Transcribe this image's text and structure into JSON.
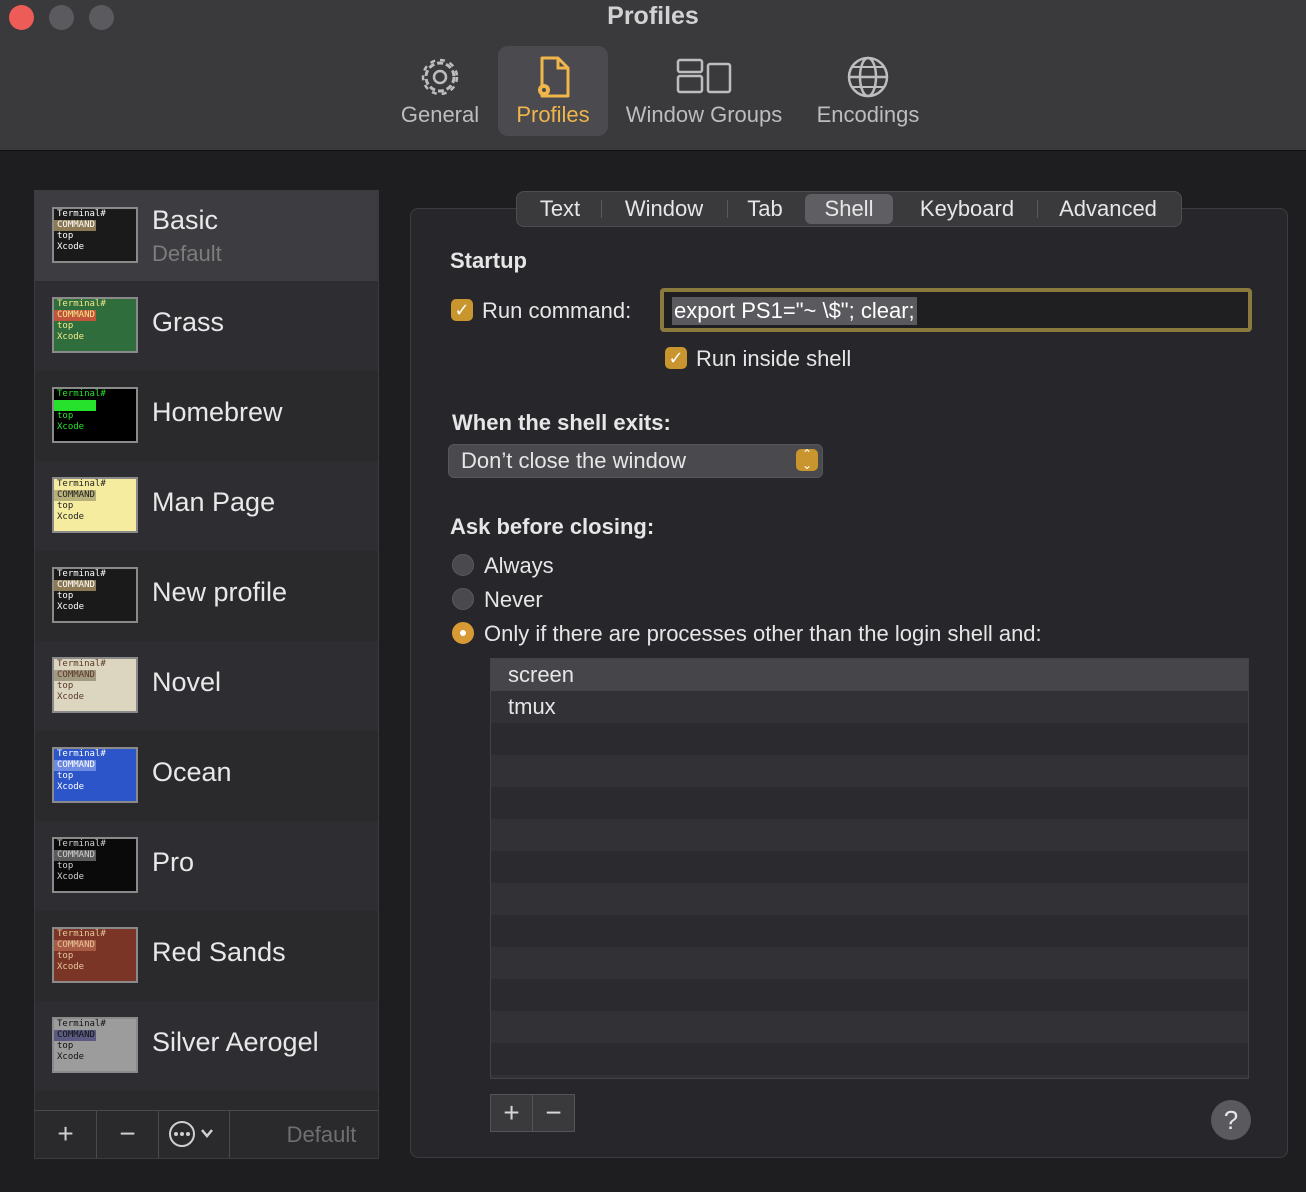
{
  "window": {
    "title": "Profiles"
  },
  "toolbar": {
    "items": [
      {
        "label": "General",
        "icon": "gear-icon"
      },
      {
        "label": "Profiles",
        "icon": "profile-document-icon",
        "active": true
      },
      {
        "label": "Window Groups",
        "icon": "window-groups-icon"
      },
      {
        "label": "Encodings",
        "icon": "globe-icon"
      }
    ]
  },
  "sidebar": {
    "profiles": [
      {
        "name": "Basic",
        "subtitle": "Default",
        "selected": true,
        "thumb": {
          "bg": "#1a1a1a",
          "fg": "#ffffff",
          "accent": "#8c7a55"
        }
      },
      {
        "name": "Grass",
        "thumb": {
          "bg": "#2f6e3c",
          "fg": "#f4e88a",
          "accent": "#c1543a"
        }
      },
      {
        "name": "Homebrew",
        "thumb": {
          "bg": "#000000",
          "fg": "#27e22c",
          "accent": "#27e22c"
        }
      },
      {
        "name": "Man Page",
        "thumb": {
          "bg": "#f5ec9f",
          "fg": "#222222",
          "accent": "#b7b07a"
        }
      },
      {
        "name": "New profile",
        "thumb": {
          "bg": "#1a1a1a",
          "fg": "#ffffff",
          "accent": "#8c7a55"
        }
      },
      {
        "name": "Novel",
        "thumb": {
          "bg": "#dcd6c0",
          "fg": "#5a3a28",
          "accent": "#a39a82"
        }
      },
      {
        "name": "Ocean",
        "thumb": {
          "bg": "#2b55c8",
          "fg": "#ffffff",
          "accent": "#6d8be0"
        }
      },
      {
        "name": "Pro",
        "thumb": {
          "bg": "#0a0a0a",
          "fg": "#d0d0d0",
          "accent": "#5a5a5a"
        }
      },
      {
        "name": "Red Sands",
        "thumb": {
          "bg": "#7a3526",
          "fg": "#e8c79a",
          "accent": "#a75a44"
        }
      },
      {
        "name": "Silver Aerogel",
        "thumb": {
          "bg": "#9c9c9c",
          "fg": "#111111",
          "accent": "#5a5a80"
        }
      }
    ],
    "thumb_lines": [
      "Terminal#",
      "COMMAND",
      "top",
      "Xcode"
    ],
    "footer": {
      "add": "+",
      "remove": "−",
      "more_icon": "ellipsis-circle-icon",
      "default_label": "Default"
    }
  },
  "tabs": {
    "items": [
      "Text",
      "Window",
      "Tab",
      "Shell",
      "Keyboard",
      "Advanced"
    ],
    "active": "Shell"
  },
  "shell": {
    "startup_heading": "Startup",
    "run_command_label": "Run command:",
    "run_command_checked": true,
    "run_command_value": "export PS1=\"~ \\$\"; clear;",
    "run_inside_shell_label": "Run inside shell",
    "run_inside_shell_checked": true,
    "exit_heading": "When the shell exits:",
    "exit_value": "Don’t close the window",
    "ask_heading": "Ask before closing:",
    "ask_options": [
      "Always",
      "Never",
      "Only if there are processes other than the login shell and:"
    ],
    "ask_selected": 2,
    "processes": [
      "screen",
      "tmux"
    ],
    "add": "+",
    "remove": "−",
    "help": "?"
  },
  "colors": {
    "accent": "#c9952f",
    "toolbar_active": "#f0b54b"
  }
}
